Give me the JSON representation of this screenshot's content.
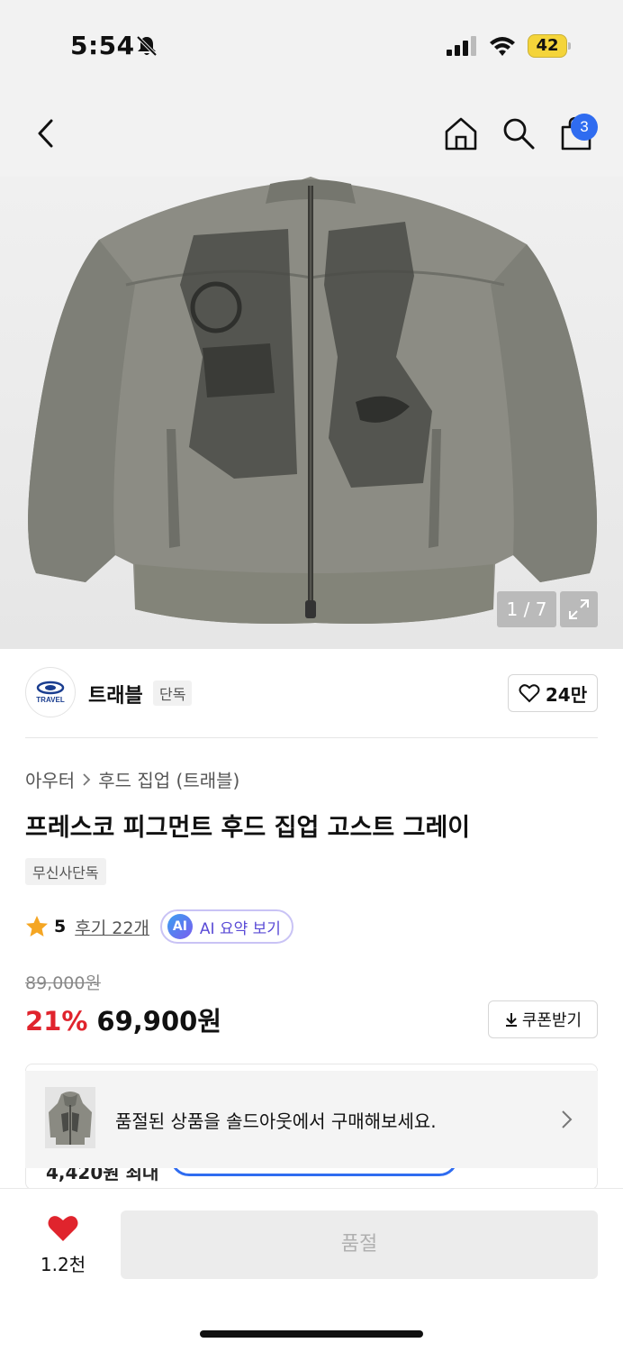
{
  "status_bar": {
    "time": "5:54",
    "battery": "42"
  },
  "nav": {
    "cart_count": "3"
  },
  "gallery": {
    "counter": "1 / 7"
  },
  "brand": {
    "name": "트래블",
    "tag": "단독",
    "logo_text": "TRAVEL",
    "like_count": "24만"
  },
  "breadcrumb": [
    "아우터",
    "후드 집업 (트래블)"
  ],
  "product": {
    "title": "프레스코 피그먼트 후드 집업 고스트 그레이",
    "exclusive_badge": "무신사단독",
    "rating": "5",
    "review_link": "후기 22개",
    "ai_summary": {
      "icon_text": "AI",
      "label": "AI 요약 보기"
    },
    "original_price": "89,000원",
    "discount": "21%",
    "sale_price": "69,900원",
    "coupon_label": "쿠폰받기"
  },
  "hidden_card": {
    "partial_text": "4,420원 최대"
  },
  "soldout_banner": {
    "text": "품절된 상품을 솔드아웃에서 구매해보세요."
  },
  "bottom_bar": {
    "wish_count": "1.2천",
    "buy_label": "품절"
  },
  "colors": {
    "accent_blue": "#2f6cf0",
    "discount_red": "#e0242d",
    "heart_red": "#e0242d",
    "battery_yellow": "#f4d43a"
  }
}
